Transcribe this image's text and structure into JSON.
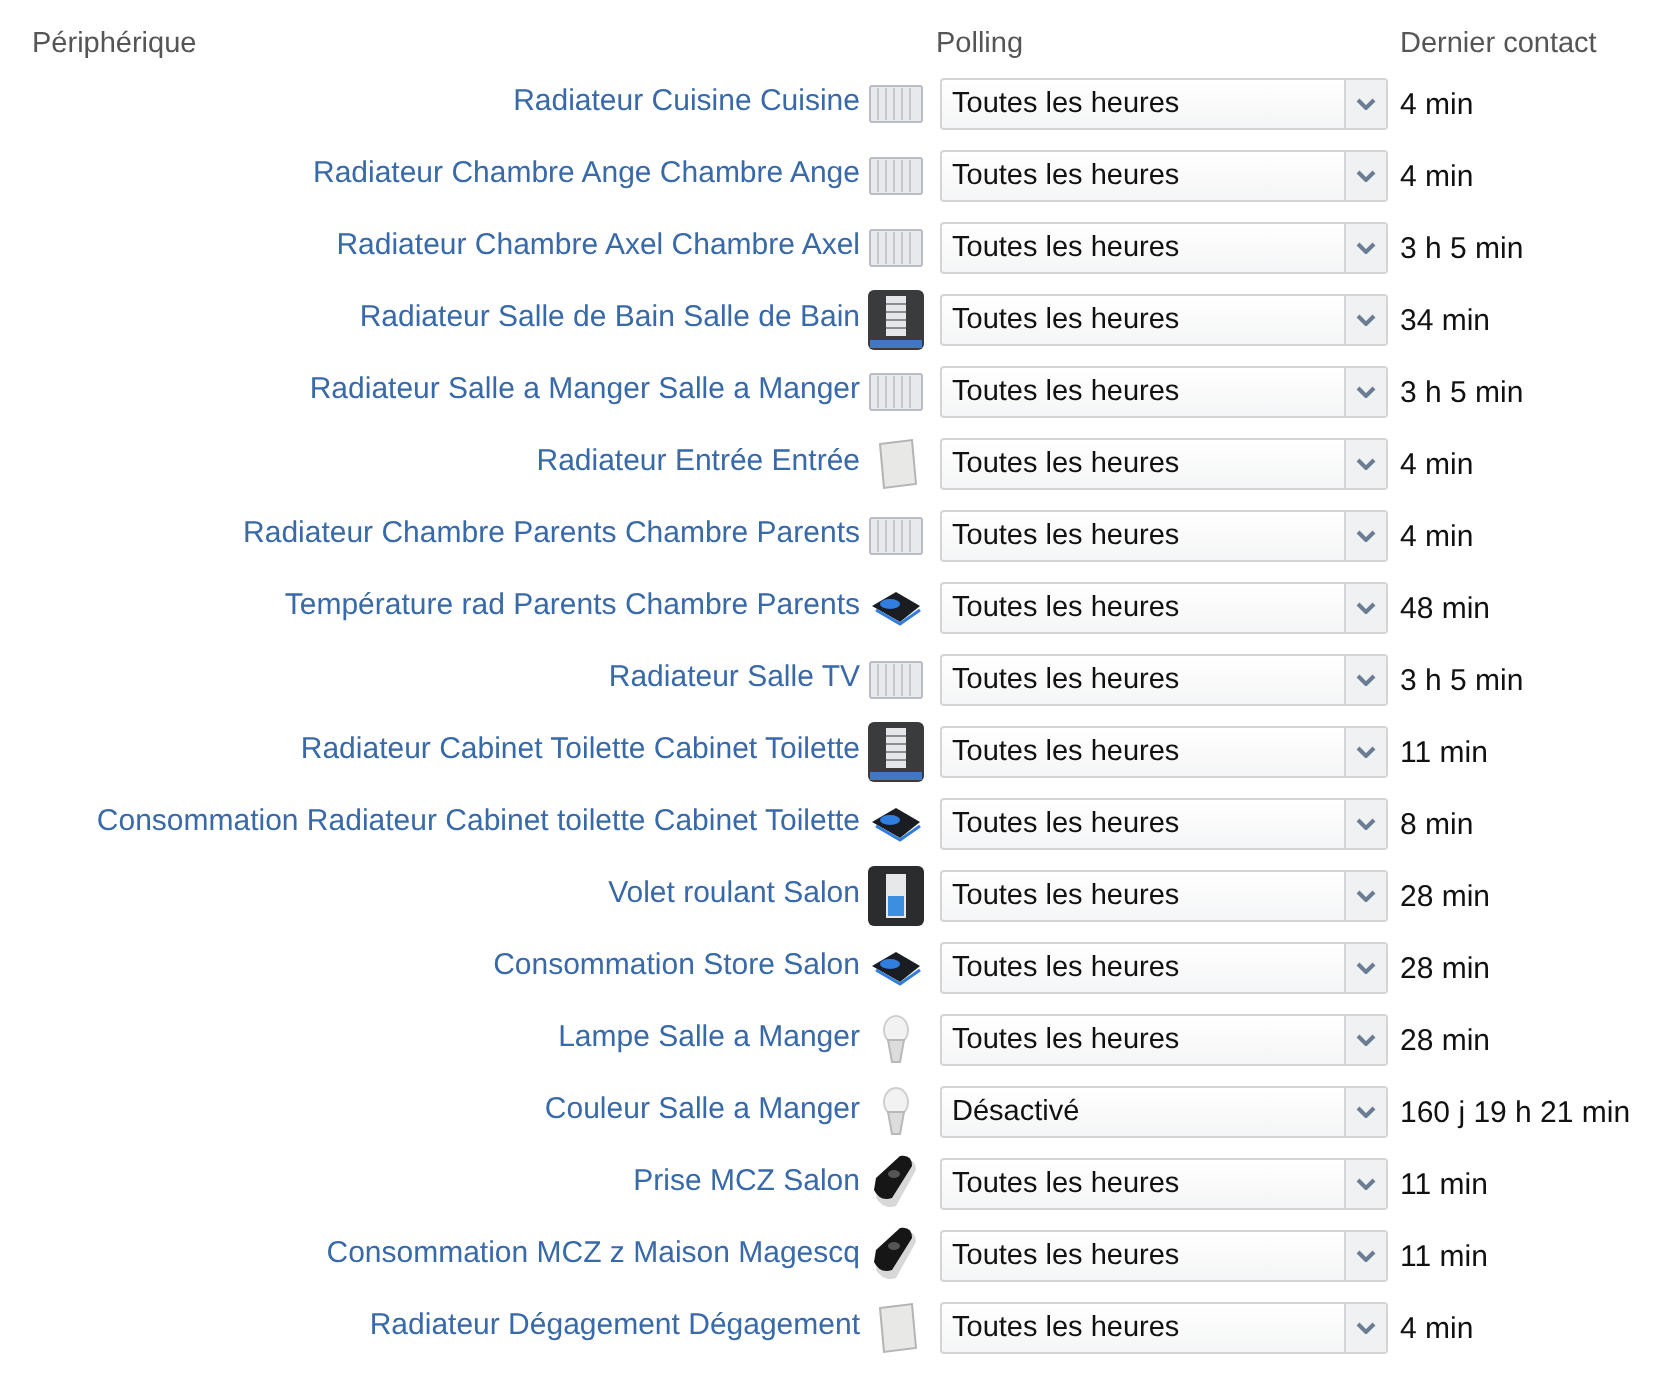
{
  "columns": [
    "Périphérique",
    "Polling",
    "Dernier contact"
  ],
  "rows": [
    {
      "name": "Radiateur Cuisine Cuisine",
      "kind": "radiator",
      "polling": "Toutes les heures",
      "contact": "4 min"
    },
    {
      "name": "Radiateur Chambre Ange Chambre Ange",
      "kind": "radiator",
      "polling": "Toutes les heures",
      "contact": "4 min"
    },
    {
      "name": "Radiateur Chambre Axel Chambre Axel",
      "kind": "radiator",
      "polling": "Toutes les heures",
      "contact": "3 h 5 min"
    },
    {
      "name": "Radiateur Salle de Bain Salle de Bain",
      "kind": "towel",
      "polling": "Toutes les heures",
      "contact": "34 min"
    },
    {
      "name": "Radiateur Salle a Manger Salle a Manger",
      "kind": "radiator",
      "polling": "Toutes les heures",
      "contact": "3 h 5 min"
    },
    {
      "name": "Radiateur Entrée Entrée",
      "kind": "panel",
      "polling": "Toutes les heures",
      "contact": "4 min"
    },
    {
      "name": "Radiateur Chambre Parents Chambre Parents",
      "kind": "radiator",
      "polling": "Toutes les heures",
      "contact": "4 min"
    },
    {
      "name": "Température rad Parents Chambre Parents",
      "kind": "sensor",
      "polling": "Toutes les heures",
      "contact": "48 min"
    },
    {
      "name": "Radiateur Salle TV",
      "kind": "radiator",
      "polling": "Toutes les heures",
      "contact": "3 h 5 min"
    },
    {
      "name": "Radiateur Cabinet Toilette Cabinet Toilette",
      "kind": "towel",
      "polling": "Toutes les heures",
      "contact": "11 min"
    },
    {
      "name": "Consommation Radiateur Cabinet toilette Cabinet Toilette",
      "kind": "sensor",
      "polling": "Toutes les heures",
      "contact": "8 min"
    },
    {
      "name": "Volet roulant Salon",
      "kind": "shutter",
      "polling": "Toutes les heures",
      "contact": "28 min"
    },
    {
      "name": "Consommation Store Salon",
      "kind": "sensor",
      "polling": "Toutes les heures",
      "contact": "28 min"
    },
    {
      "name": "Lampe Salle a Manger",
      "kind": "bulb",
      "polling": "Toutes les heures",
      "contact": "28 min"
    },
    {
      "name": "Couleur Salle a Manger",
      "kind": "bulb",
      "polling": "Désactivé",
      "contact": "160 j 19 h 21 min"
    },
    {
      "name": "Prise MCZ Salon",
      "kind": "plug",
      "polling": "Toutes les heures",
      "contact": "11 min"
    },
    {
      "name": "Consommation MCZ z Maison Magescq",
      "kind": "plug",
      "polling": "Toutes les heures",
      "contact": "11 min"
    },
    {
      "name": "Radiateur Dégagement Dégagement",
      "kind": "panel",
      "polling": "Toutes les heures",
      "contact": "4 min"
    }
  ]
}
